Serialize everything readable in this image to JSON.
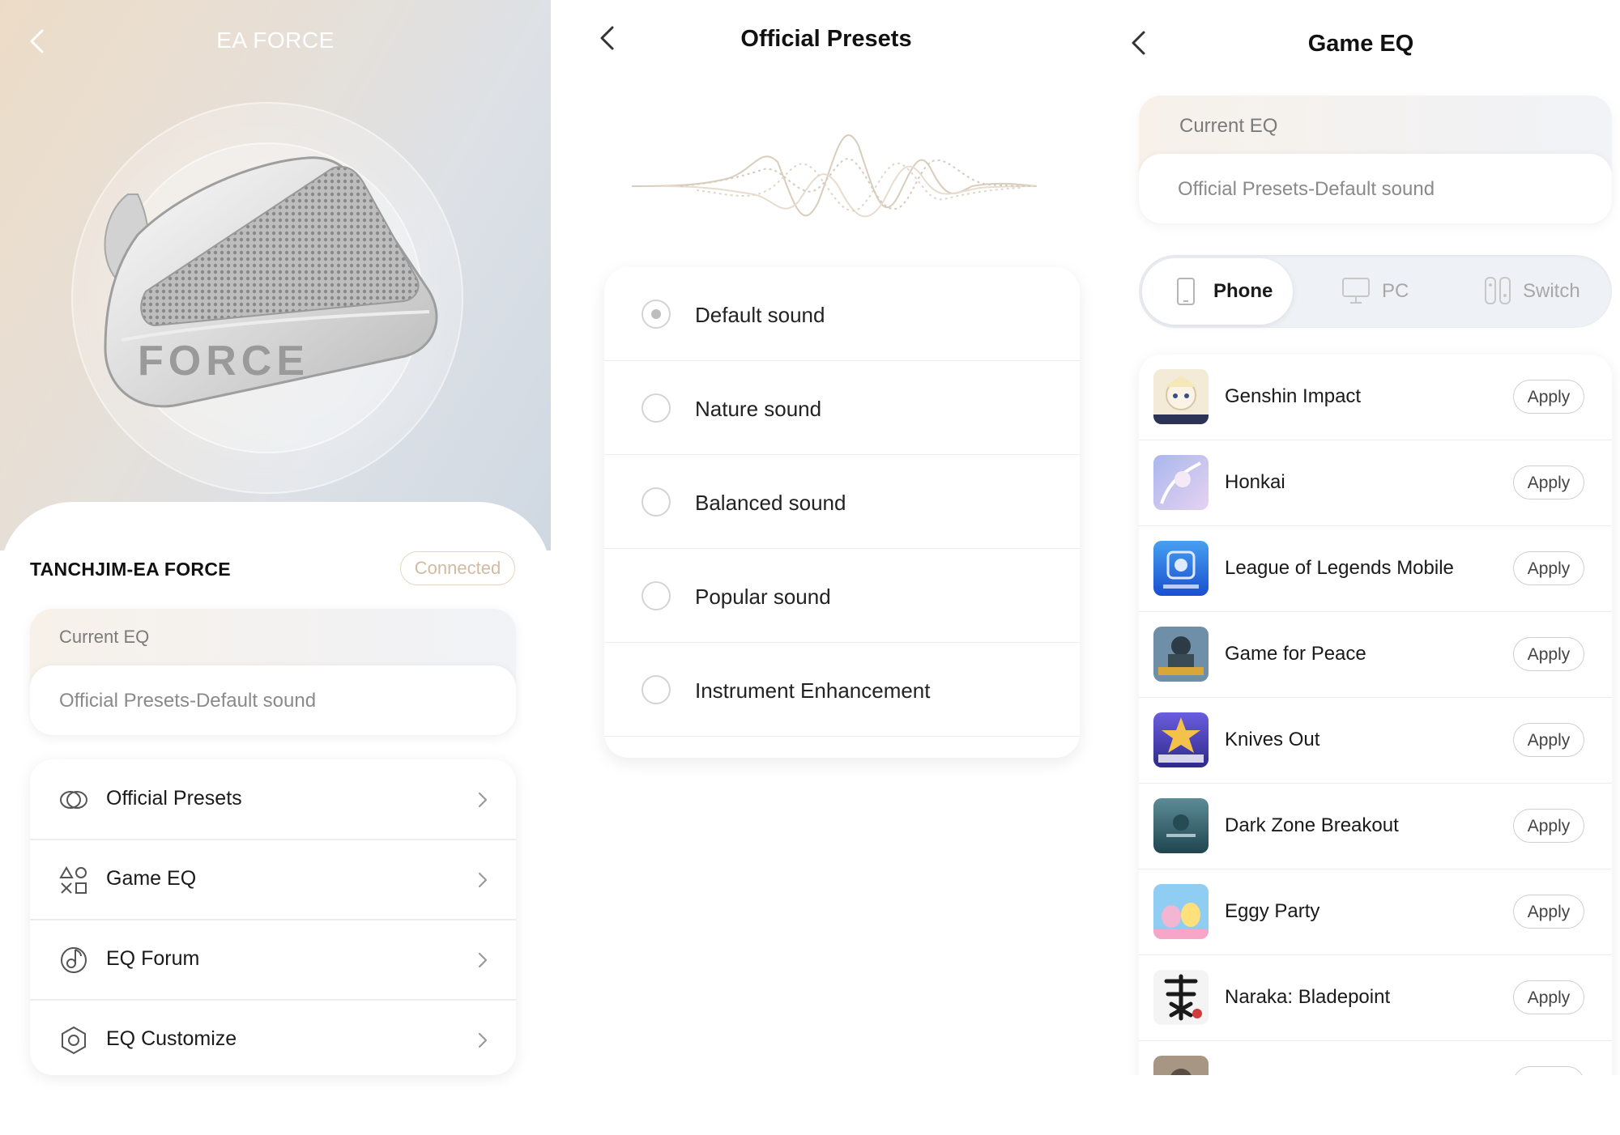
{
  "device_screen": {
    "title": "EA FORCE",
    "product_badge_text": "FORCE",
    "device_name": "TANCHJIM-EA FORCE",
    "connection_status": "Connected",
    "current_eq": {
      "label": "Current EQ",
      "value": "Official Presets-Default sound"
    },
    "menu": [
      {
        "label": "Official Presets",
        "icon": "rings-icon"
      },
      {
        "label": "Game EQ",
        "icon": "game-shapes-icon"
      },
      {
        "label": "EQ Forum",
        "icon": "music-note-icon"
      },
      {
        "label": "EQ Customize",
        "icon": "hexagon-icon"
      }
    ]
  },
  "presets_screen": {
    "title": "Official Presets",
    "selected_index": 0,
    "presets": [
      {
        "label": "Default sound"
      },
      {
        "label": "Nature sound"
      },
      {
        "label": "Balanced sound"
      },
      {
        "label": "Popular sound"
      },
      {
        "label": "Instrument Enhancement"
      }
    ]
  },
  "game_eq_screen": {
    "title": "Game EQ",
    "current_eq": {
      "label": "Current EQ",
      "value": "Official Presets-Default sound"
    },
    "platform_tabs": [
      {
        "label": "Phone",
        "icon": "phone-icon",
        "active": true
      },
      {
        "label": "PC",
        "icon": "monitor-icon",
        "active": false
      },
      {
        "label": "Switch",
        "icon": "switch-console-icon",
        "active": false
      }
    ],
    "apply_label": "Apply",
    "games": [
      {
        "name": "Genshin Impact",
        "thumb_colors": [
          "#f3ead7",
          "#3a4a8a"
        ]
      },
      {
        "name": "Honkai",
        "thumb_colors": [
          "#a9b7ee",
          "#e6d2f0"
        ]
      },
      {
        "name": "League of Legends Mobile",
        "thumb_colors": [
          "#1a4fd1",
          "#46a0f0"
        ]
      },
      {
        "name": "Game for Peace",
        "thumb_colors": [
          "#6f8fa8",
          "#2c3b46"
        ]
      },
      {
        "name": "Knives Out",
        "thumb_colors": [
          "#6b5de0",
          "#2f2a8a"
        ]
      },
      {
        "name": "Dark Zone Breakout",
        "thumb_colors": [
          "#1f4550",
          "#5d8c96"
        ]
      },
      {
        "name": "Eggy Party",
        "thumb_colors": [
          "#f2b6d2",
          "#8fcdf3"
        ]
      },
      {
        "name": "Naraka: Bladepoint",
        "thumb_colors": [
          "#f4f4f4",
          "#1a1a1a"
        ]
      },
      {
        "name": "",
        "thumb_colors": [
          "#5a4d44",
          "#a89684"
        ]
      }
    ]
  }
}
